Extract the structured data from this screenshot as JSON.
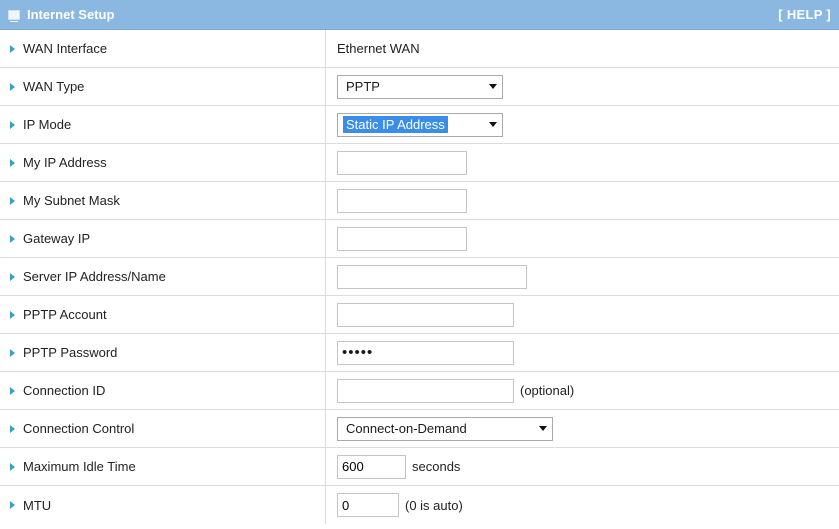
{
  "header": {
    "title": "Internet Setup",
    "help": "[ HELP ]"
  },
  "rows": {
    "wan_interface": {
      "label": "WAN Interface",
      "value": "Ethernet WAN"
    },
    "wan_type": {
      "label": "WAN Type",
      "value": "PPTP"
    },
    "ip_mode": {
      "label": "IP Mode",
      "value": "Static IP Address"
    },
    "my_ip": {
      "label": "My IP Address",
      "value": ""
    },
    "subnet": {
      "label": "My Subnet Mask",
      "value": ""
    },
    "gateway": {
      "label": "Gateway IP",
      "value": ""
    },
    "server": {
      "label": "Server IP Address/Name",
      "value": ""
    },
    "account": {
      "label": "PPTP Account",
      "value": ""
    },
    "password": {
      "label": "PPTP Password",
      "value": "•••••"
    },
    "conn_id": {
      "label": "Connection ID",
      "value": "",
      "suffix": "(optional)"
    },
    "conn_control": {
      "label": "Connection Control",
      "value": "Connect-on-Demand"
    },
    "idle": {
      "label": "Maximum Idle Time",
      "value": "600",
      "suffix": "seconds"
    },
    "mtu": {
      "label": "MTU",
      "value": "0",
      "suffix": "(0 is auto)"
    }
  },
  "colors": {
    "header_bg": "#8ab8e0",
    "arrow": "#3aa0c6",
    "selection": "#3b8ee8"
  },
  "icons": {
    "header": "window-icon",
    "row": "triangle-right-icon",
    "select": "chevron-down-icon"
  }
}
